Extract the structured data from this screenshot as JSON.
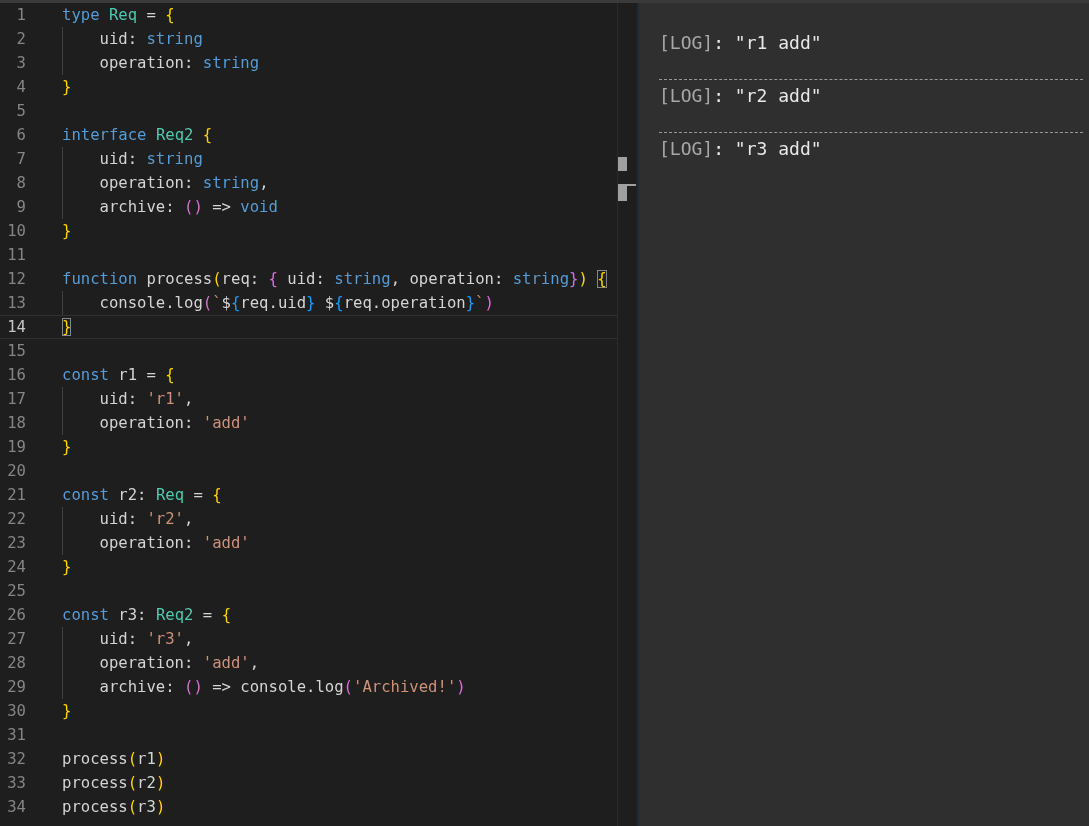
{
  "editor": {
    "lines": [
      {
        "number": "1",
        "indented": false,
        "current": false,
        "tokens": [
          {
            "kind": "kw",
            "text": "type"
          },
          {
            "kind": "type",
            "text": " Req"
          },
          {
            "kind": "text",
            "text": " = "
          },
          {
            "kind": "b1",
            "text": "{"
          }
        ]
      },
      {
        "number": "2",
        "indented": true,
        "current": false,
        "tokens": [
          {
            "kind": "text",
            "text": "uid: "
          },
          {
            "kind": "kw",
            "text": "string"
          }
        ]
      },
      {
        "number": "3",
        "indented": true,
        "current": false,
        "tokens": [
          {
            "kind": "text",
            "text": "operation: "
          },
          {
            "kind": "kw",
            "text": "string"
          }
        ]
      },
      {
        "number": "4",
        "indented": false,
        "current": false,
        "tokens": [
          {
            "kind": "b1",
            "text": "}"
          }
        ]
      },
      {
        "number": "5",
        "current": false
      },
      {
        "number": "6",
        "indented": false,
        "current": false,
        "tokens": [
          {
            "kind": "kw",
            "text": "interface"
          },
          {
            "kind": "type",
            "text": " Req2"
          },
          {
            "kind": "b1",
            "text": " {"
          }
        ]
      },
      {
        "number": "7",
        "indented": true,
        "current": false,
        "tokens": [
          {
            "kind": "text",
            "text": "uid: "
          },
          {
            "kind": "kw",
            "text": "string"
          }
        ]
      },
      {
        "number": "8",
        "indented": true,
        "current": false,
        "tokens": [
          {
            "kind": "text",
            "text": "operation: "
          },
          {
            "kind": "kw",
            "text": "string"
          },
          {
            "kind": "text",
            "text": ","
          }
        ]
      },
      {
        "number": "9",
        "indented": true,
        "current": false,
        "tokens": [
          {
            "kind": "text",
            "text": "archive: "
          },
          {
            "kind": "b2",
            "text": "()"
          },
          {
            "kind": "text",
            "text": " => "
          },
          {
            "kind": "kw",
            "text": "void"
          }
        ]
      },
      {
        "number": "10",
        "indented": false,
        "current": false,
        "tokens": [
          {
            "kind": "b1",
            "text": "}"
          }
        ]
      },
      {
        "number": "11",
        "current": false
      },
      {
        "number": "12",
        "indented": false,
        "current": false,
        "tokens": [
          {
            "kind": "kw",
            "text": "function"
          },
          {
            "kind": "text",
            "text": " process"
          },
          {
            "kind": "b1",
            "text": "("
          },
          {
            "kind": "text",
            "text": "req: "
          },
          {
            "kind": "b2",
            "text": "{"
          },
          {
            "kind": "text",
            "text": " uid: "
          },
          {
            "kind": "kw",
            "text": "string"
          },
          {
            "kind": "text",
            "text": ", operation: "
          },
          {
            "kind": "kw",
            "text": "string"
          },
          {
            "kind": "b2",
            "text": "}"
          },
          {
            "kind": "b1",
            "text": ") "
          },
          {
            "kind": "b1",
            "text": "{",
            "matched": true
          }
        ]
      },
      {
        "number": "13",
        "indented": true,
        "current": false,
        "tokens": [
          {
            "kind": "text",
            "text": "console.log"
          },
          {
            "kind": "b2",
            "text": "("
          },
          {
            "kind": "str",
            "text": "`"
          },
          {
            "kind": "text",
            "text": "$"
          },
          {
            "kind": "b3",
            "text": "{"
          },
          {
            "kind": "text",
            "text": "req.uid"
          },
          {
            "kind": "b3",
            "text": "}"
          },
          {
            "kind": "text",
            "text": " $"
          },
          {
            "kind": "b3",
            "text": "{"
          },
          {
            "kind": "text",
            "text": "req.operation"
          },
          {
            "kind": "b3",
            "text": "}"
          },
          {
            "kind": "str",
            "text": "`"
          },
          {
            "kind": "b2",
            "text": ")"
          }
        ]
      },
      {
        "number": "14",
        "indented": false,
        "current": true,
        "tokens": [
          {
            "kind": "b1",
            "text": "}",
            "matched": true
          }
        ]
      },
      {
        "number": "15",
        "current": false
      },
      {
        "number": "16",
        "indented": false,
        "current": false,
        "tokens": [
          {
            "kind": "kw",
            "text": "const"
          },
          {
            "kind": "text",
            "text": " r1 = "
          },
          {
            "kind": "b1",
            "text": "{"
          }
        ]
      },
      {
        "number": "17",
        "indented": true,
        "current": false,
        "tokens": [
          {
            "kind": "text",
            "text": "uid: "
          },
          {
            "kind": "str",
            "text": "'r1'"
          },
          {
            "kind": "text",
            "text": ","
          }
        ]
      },
      {
        "number": "18",
        "indented": true,
        "current": false,
        "tokens": [
          {
            "kind": "text",
            "text": "operation: "
          },
          {
            "kind": "str",
            "text": "'add'"
          }
        ]
      },
      {
        "number": "19",
        "indented": false,
        "current": false,
        "tokens": [
          {
            "kind": "b1",
            "text": "}"
          }
        ]
      },
      {
        "number": "20",
        "current": false
      },
      {
        "number": "21",
        "indented": false,
        "current": false,
        "tokens": [
          {
            "kind": "kw",
            "text": "const"
          },
          {
            "kind": "text",
            "text": " r2: "
          },
          {
            "kind": "type",
            "text": "Req"
          },
          {
            "kind": "text",
            "text": " = "
          },
          {
            "kind": "b1",
            "text": "{"
          }
        ]
      },
      {
        "number": "22",
        "indented": true,
        "current": false,
        "tokens": [
          {
            "kind": "text",
            "text": "uid: "
          },
          {
            "kind": "str",
            "text": "'r2'"
          },
          {
            "kind": "text",
            "text": ","
          }
        ]
      },
      {
        "number": "23",
        "indented": true,
        "current": false,
        "tokens": [
          {
            "kind": "text",
            "text": "operation: "
          },
          {
            "kind": "str",
            "text": "'add'"
          }
        ]
      },
      {
        "number": "24",
        "indented": false,
        "current": false,
        "tokens": [
          {
            "kind": "b1",
            "text": "}"
          }
        ]
      },
      {
        "number": "25",
        "current": false
      },
      {
        "number": "26",
        "indented": false,
        "current": false,
        "tokens": [
          {
            "kind": "kw",
            "text": "const"
          },
          {
            "kind": "text",
            "text": " r3: "
          },
          {
            "kind": "type",
            "text": "Req2"
          },
          {
            "kind": "text",
            "text": " = "
          },
          {
            "kind": "b1",
            "text": "{"
          }
        ]
      },
      {
        "number": "27",
        "indented": true,
        "current": false,
        "tokens": [
          {
            "kind": "text",
            "text": "uid: "
          },
          {
            "kind": "str",
            "text": "'r3'"
          },
          {
            "kind": "text",
            "text": ","
          }
        ]
      },
      {
        "number": "28",
        "indented": true,
        "current": false,
        "tokens": [
          {
            "kind": "text",
            "text": "operation: "
          },
          {
            "kind": "str",
            "text": "'add'"
          },
          {
            "kind": "text",
            "text": ","
          }
        ]
      },
      {
        "number": "29",
        "indented": true,
        "current": false,
        "tokens": [
          {
            "kind": "text",
            "text": "archive: "
          },
          {
            "kind": "b2",
            "text": "()"
          },
          {
            "kind": "text",
            "text": " => console.log"
          },
          {
            "kind": "b2",
            "text": "("
          },
          {
            "kind": "str",
            "text": "'Archived!'"
          },
          {
            "kind": "b2",
            "text": ")"
          }
        ]
      },
      {
        "number": "30",
        "indented": false,
        "current": false,
        "tokens": [
          {
            "kind": "b1",
            "text": "}"
          }
        ]
      },
      {
        "number": "31",
        "current": false
      },
      {
        "number": "32",
        "indented": false,
        "current": false,
        "tokens": [
          {
            "kind": "text",
            "text": "process"
          },
          {
            "kind": "b1",
            "text": "("
          },
          {
            "kind": "text",
            "text": "r1"
          },
          {
            "kind": "b1",
            "text": ")"
          }
        ]
      },
      {
        "number": "33",
        "indented": false,
        "current": false,
        "tokens": [
          {
            "kind": "text",
            "text": "process"
          },
          {
            "kind": "b1",
            "text": "("
          },
          {
            "kind": "text",
            "text": "r2"
          },
          {
            "kind": "b1",
            "text": ")"
          }
        ]
      },
      {
        "number": "34",
        "indented": false,
        "current": false,
        "tokens": [
          {
            "kind": "text",
            "text": "process"
          },
          {
            "kind": "b1",
            "text": "("
          },
          {
            "kind": "text",
            "text": "r3"
          },
          {
            "kind": "b1",
            "text": ")"
          }
        ]
      }
    ]
  },
  "console": {
    "entries": [
      {
        "tag": "[LOG]",
        "message": ": \"r1 add\""
      },
      {
        "tag": "[LOG]",
        "message": ": \"r2 add\""
      },
      {
        "tag": "[LOG]",
        "message": ": \"r3 add\""
      }
    ]
  }
}
